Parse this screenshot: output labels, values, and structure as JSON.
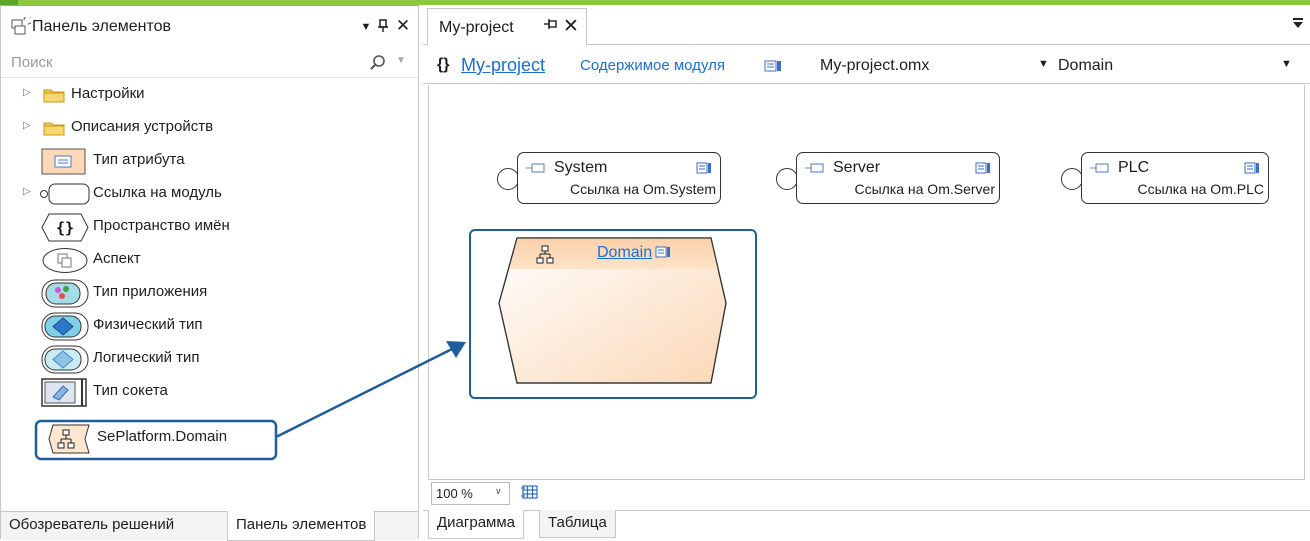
{
  "toolbox": {
    "title": "Панель элементов",
    "title_icon": "toolbox-icon",
    "controls": {
      "dropdown": "▼",
      "pin": "ᵖ",
      "close": "✕"
    },
    "search_placeholder": "Поиск",
    "items": [
      {
        "label": "Настройки",
        "icon": "folder-icon",
        "expandable": true
      },
      {
        "label": "Описания устройств",
        "icon": "folder-icon",
        "expandable": true
      },
      {
        "label": "Тип атрибута",
        "icon": "attribute-type-icon",
        "expandable": false
      },
      {
        "label": "Ссылка на модуль",
        "icon": "module-reference-icon",
        "expandable": true
      },
      {
        "label": "Пространство имён",
        "icon": "namespace-icon",
        "glyph": "{}",
        "expandable": false
      },
      {
        "label": "Аспект",
        "icon": "aspect-icon",
        "expandable": false
      },
      {
        "label": "Тип приложения",
        "icon": "application-type-icon",
        "expandable": false
      },
      {
        "label": "Физический тип",
        "icon": "physical-type-icon",
        "expandable": false
      },
      {
        "label": "Логический тип",
        "icon": "logical-type-icon",
        "expandable": false
      },
      {
        "label": "Тип сокета",
        "icon": "socket-type-icon",
        "expandable": false
      },
      {
        "label": "SePlatform.Domain",
        "icon": "domain-icon",
        "expandable": false,
        "highlighted": true
      }
    ],
    "bottom_tabs": [
      {
        "label": "Обозреватель решений",
        "active": false
      },
      {
        "label": "Панель элементов",
        "active": true
      }
    ]
  },
  "document": {
    "tab_title": "My-project",
    "tab_pin": "ᵖ",
    "tab_close": "✕",
    "navigation": {
      "braces": "{}",
      "project_link": "My-project",
      "contents_label": "Содержимое модуля",
      "file": "My-project.omx",
      "domain": "Domain"
    },
    "module_refs": [
      {
        "name": "System",
        "ref": "Ссылка на Om.System"
      },
      {
        "name": "Server",
        "ref": "Ссылка на Om.Server"
      },
      {
        "name": "PLC",
        "ref": "Ссылка на Om.PLC"
      }
    ],
    "domain_label": "Domain",
    "zoom": "100 %",
    "bottom_tabs": [
      {
        "label": "Диаграмма",
        "active": true
      },
      {
        "label": "Таблица",
        "active": false
      }
    ]
  },
  "colors": {
    "accent_green": "#8dc63f",
    "link_blue": "#1a6fd6",
    "highlight_blue": "#1e5e9a",
    "domain_fill": "#fde2c8"
  }
}
